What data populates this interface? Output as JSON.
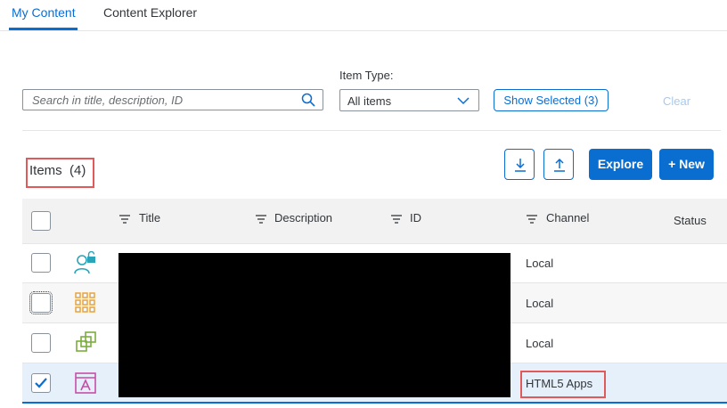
{
  "tabs": [
    {
      "label": "My Content",
      "active": true
    },
    {
      "label": "Content Explorer",
      "active": false
    }
  ],
  "filters": {
    "search_placeholder": "Search in title, description, ID",
    "item_type_label": "Item Type:",
    "item_type_value": "All items",
    "show_selected_label": "Show Selected (3)",
    "clear_label": "Clear"
  },
  "items": {
    "title": "Items",
    "count": "(4)",
    "explore_label": "Explore",
    "new_label": "+ New"
  },
  "table": {
    "columns": [
      "Title",
      "Description",
      "ID",
      "Channel",
      "Status"
    ],
    "rows": [
      {
        "icon": "role-icon",
        "channel": "Local",
        "selected": false
      },
      {
        "icon": "grid-icon",
        "channel": "Local",
        "selected": false
      },
      {
        "icon": "copy-icon",
        "channel": "Local",
        "selected": false
      },
      {
        "icon": "html5-app-icon",
        "channel": "HTML5 Apps",
        "selected": true
      }
    ]
  },
  "colors": {
    "accent": "#0a6ed1",
    "highlight_box": "#e05a5a",
    "redacted": "#000000"
  }
}
